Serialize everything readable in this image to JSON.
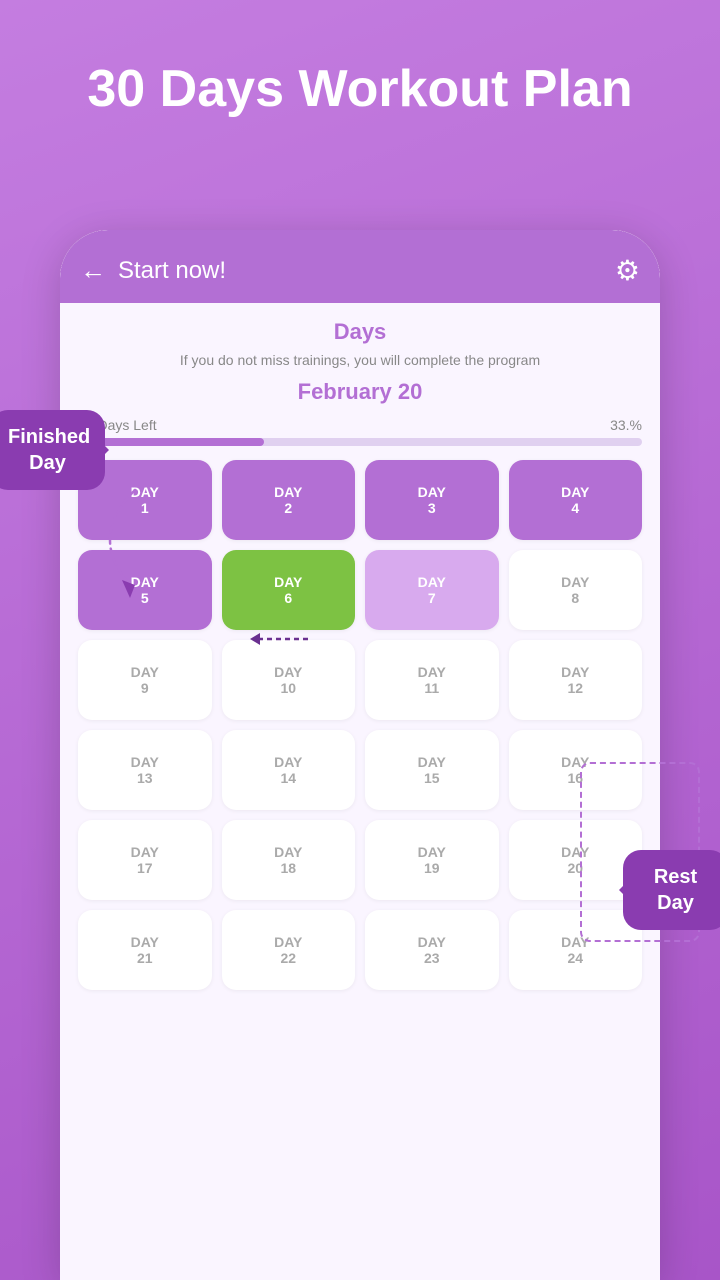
{
  "page": {
    "title": "30 Days Workout Plan",
    "bg_color": "#b36fd4"
  },
  "header": {
    "back_label": "←",
    "title": "Start now!",
    "settings_icon": "⚙"
  },
  "days_section": {
    "heading": "Days",
    "subtitle": "If you do not miss trainings, you will complete the program",
    "date": "February 20",
    "progress_left": "23 Days Left",
    "progress_percent": "33.%",
    "progress_value": 33
  },
  "tooltips": {
    "finished_day": "Finished Day",
    "rest_day": "Rest Day"
  },
  "days": [
    {
      "num": "DAY\n1",
      "type": "active-purple"
    },
    {
      "num": "DAY\n2",
      "type": "active-purple"
    },
    {
      "num": "DAY\n3",
      "type": "active-purple"
    },
    {
      "num": "DAY\n4",
      "type": "active-purple"
    },
    {
      "num": "DAY\n5",
      "type": "active-purple"
    },
    {
      "num": "DAY\n6",
      "type": "current-green"
    },
    {
      "num": "DAY\n7",
      "type": "light-purple"
    },
    {
      "num": "DAY\n8",
      "type": "rest-day"
    },
    {
      "num": "DAY\n9",
      "type": "default"
    },
    {
      "num": "DAY\n10",
      "type": "default"
    },
    {
      "num": "DAY\n11",
      "type": "default"
    },
    {
      "num": "DAY\n12",
      "type": "rest-day"
    },
    {
      "num": "DAY\n13",
      "type": "default"
    },
    {
      "num": "DAY\n14",
      "type": "default"
    },
    {
      "num": "DAY\n15",
      "type": "default"
    },
    {
      "num": "DAY\n16",
      "type": "default"
    },
    {
      "num": "DAY\n17",
      "type": "default"
    },
    {
      "num": "DAY\n18",
      "type": "default"
    },
    {
      "num": "DAY\n19",
      "type": "default"
    },
    {
      "num": "DAY\n20",
      "type": "default"
    },
    {
      "num": "DAY\n21",
      "type": "default"
    },
    {
      "num": "DAY\n22",
      "type": "default"
    },
    {
      "num": "DAY\n23",
      "type": "default"
    },
    {
      "num": "DAY\n24",
      "type": "default"
    }
  ]
}
